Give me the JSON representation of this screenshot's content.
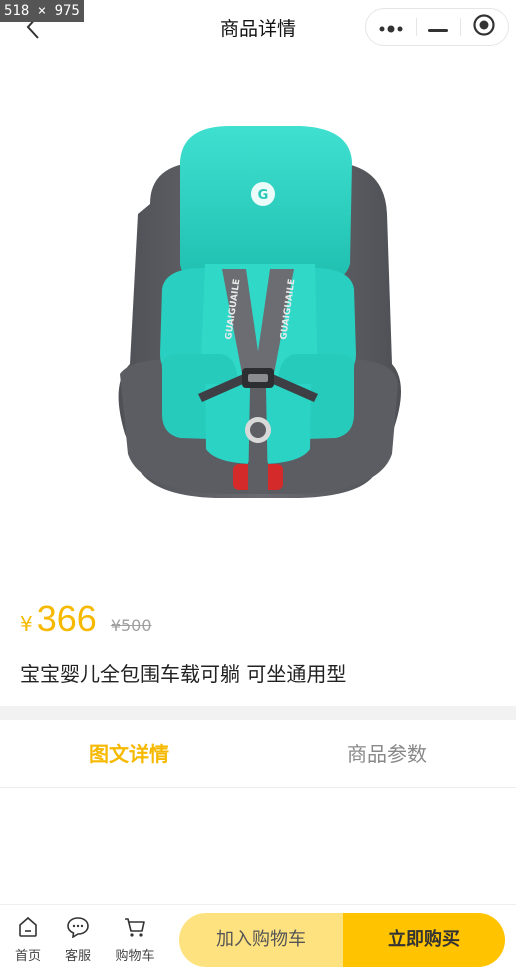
{
  "overlay": {
    "dimensions": "518 × 975"
  },
  "header": {
    "title": "商品详情",
    "back_icon": "chevron-left-icon",
    "capsule_icons": [
      "more-dots-icon",
      "minimize-icon",
      "target-icon"
    ]
  },
  "product": {
    "image_icon": "car-seat-image",
    "seat_brand_text": "GUAIGUAILE",
    "price_symbol": "¥",
    "price": "366",
    "original_price": "¥500",
    "title": "宝宝婴儿全包围车载可躺 可坐通用型"
  },
  "tabs": [
    {
      "label": "图文详情",
      "active": true
    },
    {
      "label": "商品参数",
      "active": false
    }
  ],
  "bottom_nav": [
    {
      "label": "首页",
      "icon": "home-icon"
    },
    {
      "label": "客服",
      "icon": "chat-icon"
    },
    {
      "label": "购物车",
      "icon": "cart-icon"
    }
  ],
  "actions": {
    "add_to_cart": "加入购物车",
    "buy_now": "立即购买"
  },
  "colors": {
    "accent": "#f6b900",
    "cart_button": "#ffe280",
    "buy_button": "#ffc300",
    "seat_teal": "#2fd6c6",
    "seat_gray": "#5f6166"
  }
}
